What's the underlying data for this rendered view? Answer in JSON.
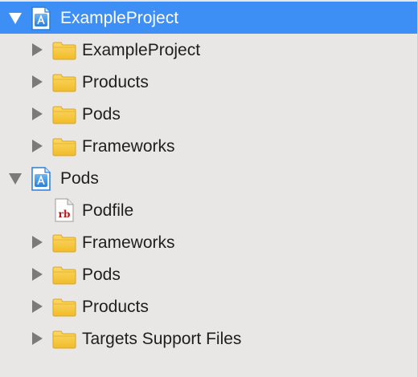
{
  "tree": {
    "items": [
      {
        "label": "ExampleProject",
        "icon": "xcode-project-icon",
        "expanded": true,
        "selected": true,
        "depth": 0
      },
      {
        "label": "ExampleProject",
        "icon": "folder-icon",
        "expanded": false,
        "depth": 1
      },
      {
        "label": "Products",
        "icon": "folder-icon",
        "expanded": false,
        "depth": 1
      },
      {
        "label": "Pods",
        "icon": "folder-icon",
        "expanded": false,
        "depth": 1
      },
      {
        "label": "Frameworks",
        "icon": "folder-icon",
        "expanded": false,
        "depth": 1
      },
      {
        "label": "Pods",
        "icon": "xcode-project-icon",
        "expanded": true,
        "depth": 0
      },
      {
        "label": "Podfile",
        "icon": "ruby-file-icon",
        "file_badge": "rb",
        "depth": 1
      },
      {
        "label": "Frameworks",
        "icon": "folder-icon",
        "expanded": false,
        "depth": 1
      },
      {
        "label": "Pods",
        "icon": "folder-icon",
        "expanded": false,
        "depth": 1
      },
      {
        "label": "Products",
        "icon": "folder-icon",
        "expanded": false,
        "depth": 1
      },
      {
        "label": "Targets Support Files",
        "icon": "folder-icon",
        "expanded": false,
        "depth": 1
      }
    ]
  },
  "colors": {
    "background": "#e9e7e6",
    "selection": "#3d8ff5",
    "folder": "#f7c843",
    "project_icon": "#2f87e0"
  }
}
